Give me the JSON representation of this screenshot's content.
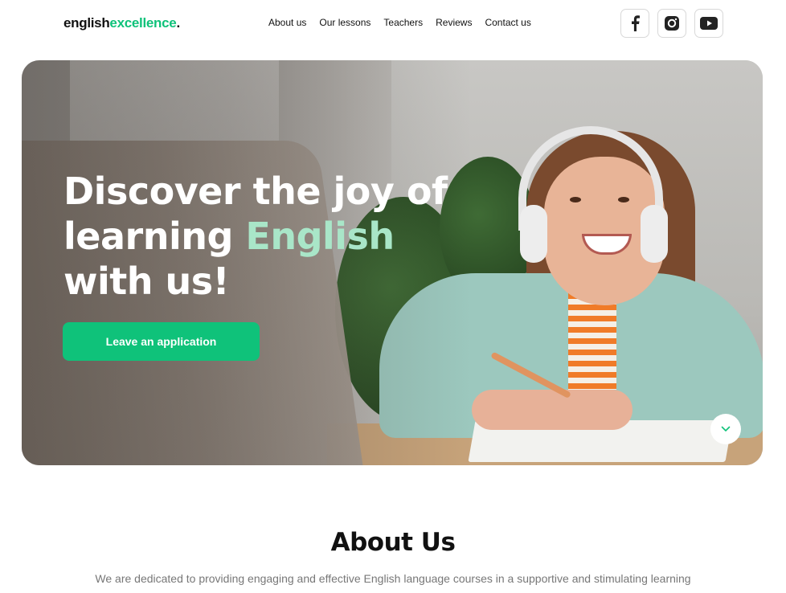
{
  "header": {
    "logo": {
      "part1": "english",
      "part2": "excellence",
      "part3": "."
    },
    "nav": [
      "About us",
      "Our lessons",
      "Teachers",
      "Reviews",
      "Contact us"
    ],
    "social": [
      "facebook-icon",
      "instagram-icon",
      "youtube-icon"
    ]
  },
  "hero": {
    "title_line1": "Discover the joy of",
    "title_line2_a": "learning ",
    "title_line2_b": "English",
    "title_line3": "with us!",
    "cta_label": "Leave an application",
    "scroll_icon": "chevron-down-icon"
  },
  "about": {
    "title_a": "About ",
    "title_b": "Us",
    "text": "We are dedicated to providing engaging and effective English language courses in a supportive and stimulating learning"
  },
  "colors": {
    "accent": "#0fc27a",
    "accent_light": "#a9e6c8"
  }
}
